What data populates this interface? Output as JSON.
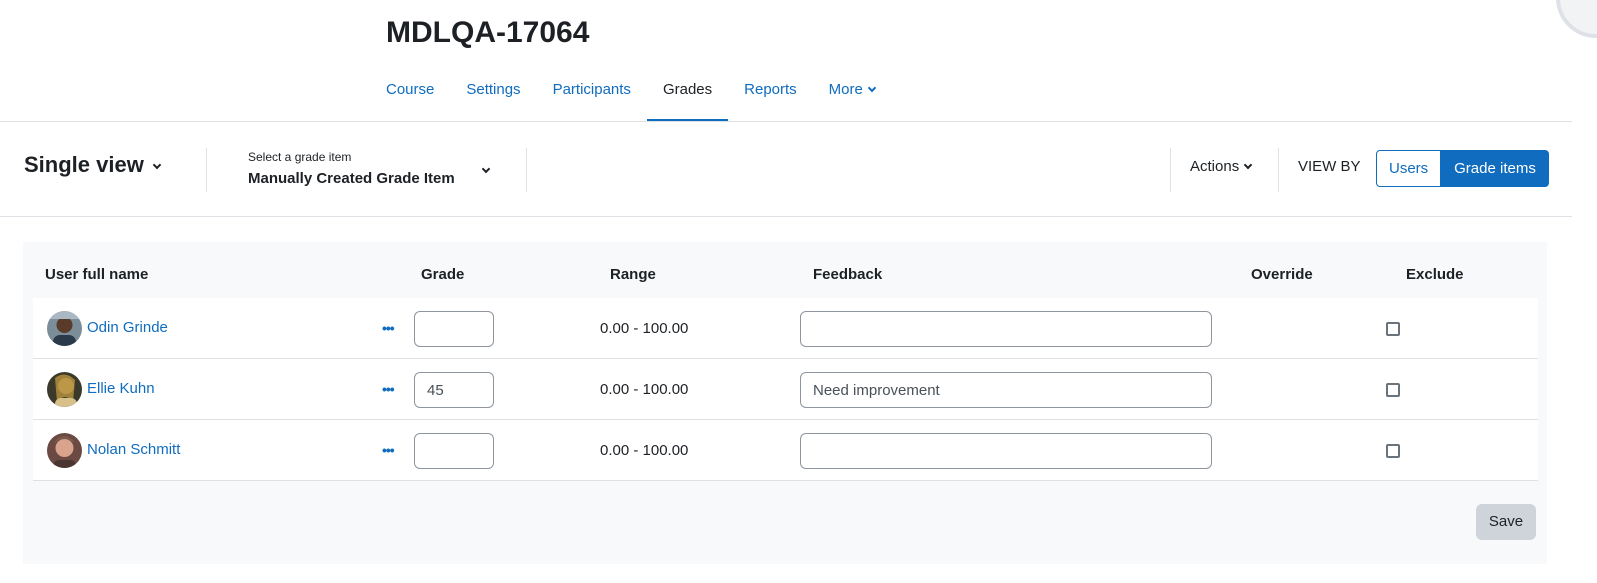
{
  "course": {
    "title": "MDLQA-17064"
  },
  "nav": {
    "tabs": [
      {
        "label": "Course"
      },
      {
        "label": "Settings"
      },
      {
        "label": "Participants"
      },
      {
        "label": "Grades",
        "active": true
      },
      {
        "label": "Reports"
      },
      {
        "label": "More"
      }
    ]
  },
  "toolbar": {
    "report_name": "Single view",
    "grade_item_caption": "Select a grade item",
    "grade_item_value": "Manually Created Grade Item",
    "actions_label": "Actions",
    "view_by_label": "VIEW BY",
    "view_by_users": "Users",
    "view_by_grade_items": "Grade items"
  },
  "table": {
    "headers": {
      "user": "User full name",
      "grade": "Grade",
      "range": "Range",
      "feedback": "Feedback",
      "override": "Override",
      "exclude": "Exclude"
    },
    "rows": [
      {
        "name": "Odin Grinde",
        "menu": "•••",
        "grade": "",
        "range": "0.00 - 100.00",
        "feedback": "",
        "excluded": false
      },
      {
        "name": "Ellie Kuhn",
        "menu": "•••",
        "grade": "45",
        "range": "0.00 - 100.00",
        "feedback": "Need improvement",
        "excluded": false
      },
      {
        "name": "Nolan Schmitt",
        "menu": "•••",
        "grade": "",
        "range": "0.00 - 100.00",
        "feedback": "",
        "excluded": false
      }
    ]
  },
  "save_label": "Save",
  "colors": {
    "accent": "#0f6cbf",
    "text": "#1d2125",
    "border": "#dee2e6",
    "panel_bg": "#f8f9fa",
    "save_bg": "#ced4da"
  }
}
